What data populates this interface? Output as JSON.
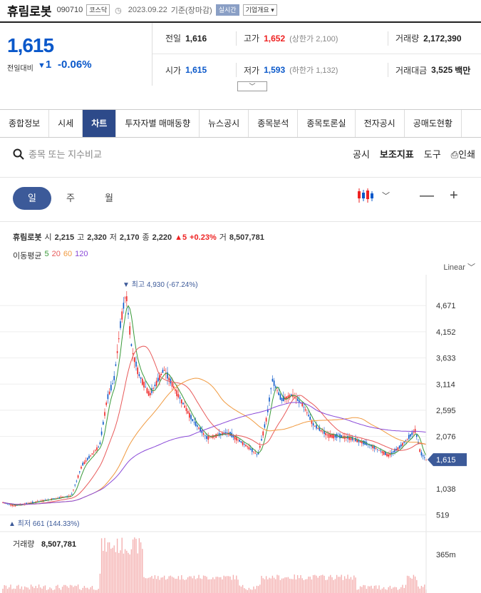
{
  "header": {
    "name": "휴림로봇",
    "code": "090710",
    "market": "코스닥",
    "date": "2023.09.22",
    "basis": "기준(장마감)",
    "realtime": "실시간",
    "company": "기업개요"
  },
  "price": {
    "current": "1,615",
    "change_label": "전일대비",
    "change": "1",
    "change_pct": "-0.06%"
  },
  "stats": {
    "prev_label": "전일",
    "prev": "1,616",
    "high_label": "고가",
    "high": "1,652",
    "upper_limit": "(상한가 2,100)",
    "volume_label": "거래량",
    "volume": "2,172,390",
    "open_label": "시가",
    "open": "1,615",
    "low_label": "저가",
    "low": "1,593",
    "lower_limit": "(하한가 1,132)",
    "amount_label": "거래대금",
    "amount": "3,525",
    "amount_unit": "백만"
  },
  "tabs": [
    "종합정보",
    "시세",
    "차트",
    "투자자별 매매동향",
    "뉴스공시",
    "종목분석",
    "종목토론실",
    "전자공시",
    "공매도현황"
  ],
  "toolbar": {
    "search_placeholder": "종목 또는 지수비교",
    "disclosure": "공시",
    "indicators": "보조지표",
    "tools": "도구",
    "print": "인쇄"
  },
  "periods": [
    "일",
    "주",
    "월"
  ],
  "info": {
    "name": "휴림로봇",
    "open_l": "시",
    "open": "2,215",
    "high_l": "고",
    "high": "2,320",
    "low_l": "저",
    "low": "2,170",
    "close_l": "종",
    "close": "2,220",
    "chg": "▲5",
    "pct": "+0.23%",
    "vol_l": "거",
    "vol": "8,507,781"
  },
  "ma": {
    "label": "이동평균",
    "p5": "5",
    "p20": "20",
    "p60": "60",
    "p120": "120",
    "c5": "#3a9a3a",
    "c20": "#e85a5a",
    "c60": "#f09a40",
    "c120": "#8a4ad8"
  },
  "scale": "Linear",
  "chart_data": {
    "type": "line",
    "y_ticks": [
      4671,
      4152,
      3633,
      3114,
      2595,
      2076,
      1038,
      519
    ],
    "ylim": [
      400,
      5000
    ],
    "max_label": "▼ 최고 4,930 (-67.24%)",
    "min_label": "▲ 최저 661 (144.33%)",
    "last_label": "1,615",
    "last": 1615,
    "volume_label": "거래량",
    "volume": "8,507,781",
    "vol_tick": "365m"
  }
}
